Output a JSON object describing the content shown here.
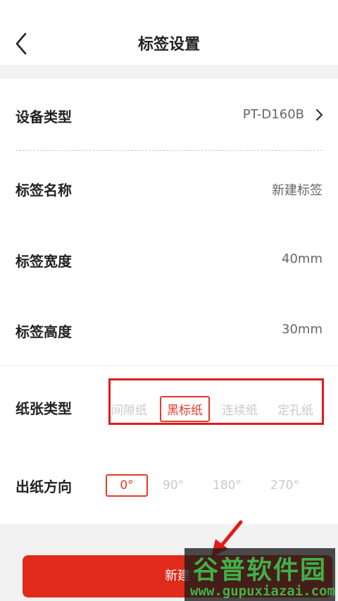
{
  "header": {
    "title": "标签设置"
  },
  "rows": {
    "device_type": {
      "label": "设备类型",
      "value": "PT-D160B"
    },
    "label_name": {
      "label": "标签名称",
      "value": "新建标签"
    },
    "label_width": {
      "label": "标签宽度",
      "value": "40mm"
    },
    "label_height": {
      "label": "标签高度",
      "value": "30mm"
    }
  },
  "paper_type": {
    "label": "纸张类型",
    "options": [
      "间隙纸",
      "黑标纸",
      "连续纸",
      "定孔纸"
    ],
    "selected": "黑标纸"
  },
  "feed_direction": {
    "label": "出纸方向",
    "options": [
      "0°",
      "90°",
      "180°",
      "270°"
    ],
    "selected": "0°"
  },
  "cta": {
    "label": "新建"
  },
  "watermark": {
    "brand": "谷普软件园",
    "url": "www.gupuxiazai.com"
  },
  "colors": {
    "accent": "#e53a2c",
    "button": "#e02b1a",
    "annotation_red": "#e11b1b",
    "watermark_green": "#3fb148"
  },
  "icons": {
    "back": "chevron-left-icon",
    "forward": "chevron-right-icon"
  }
}
